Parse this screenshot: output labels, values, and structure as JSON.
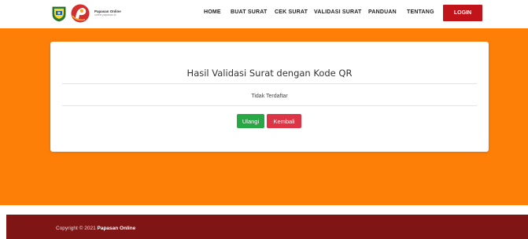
{
  "brand": {
    "name": "Papasan Online",
    "subtitle": "online.papasan.id"
  },
  "nav": {
    "items": [
      {
        "label": "HOME"
      },
      {
        "label": "BUAT SURAT"
      },
      {
        "label": "CEK SURAT"
      },
      {
        "label": "VALIDASI SURAT"
      },
      {
        "label": "PANDUAN"
      },
      {
        "label": "TENTANG"
      }
    ],
    "login_label": "LOGIN"
  },
  "card": {
    "title": "Hasil Validasi Surat dengan Kode QR",
    "status": "Tidak Terdaftar",
    "retry_label": "Ulangi",
    "back_label": "Kembali"
  },
  "footer": {
    "prefix": "Copyright © 2021 ",
    "brand": "Papasan Online"
  },
  "colors": {
    "accent_orange": "#fd7f08",
    "login_red": "#c0141a",
    "footer_maroon": "#7f1515",
    "button_green": "#28a745",
    "button_red": "#dc3545"
  }
}
